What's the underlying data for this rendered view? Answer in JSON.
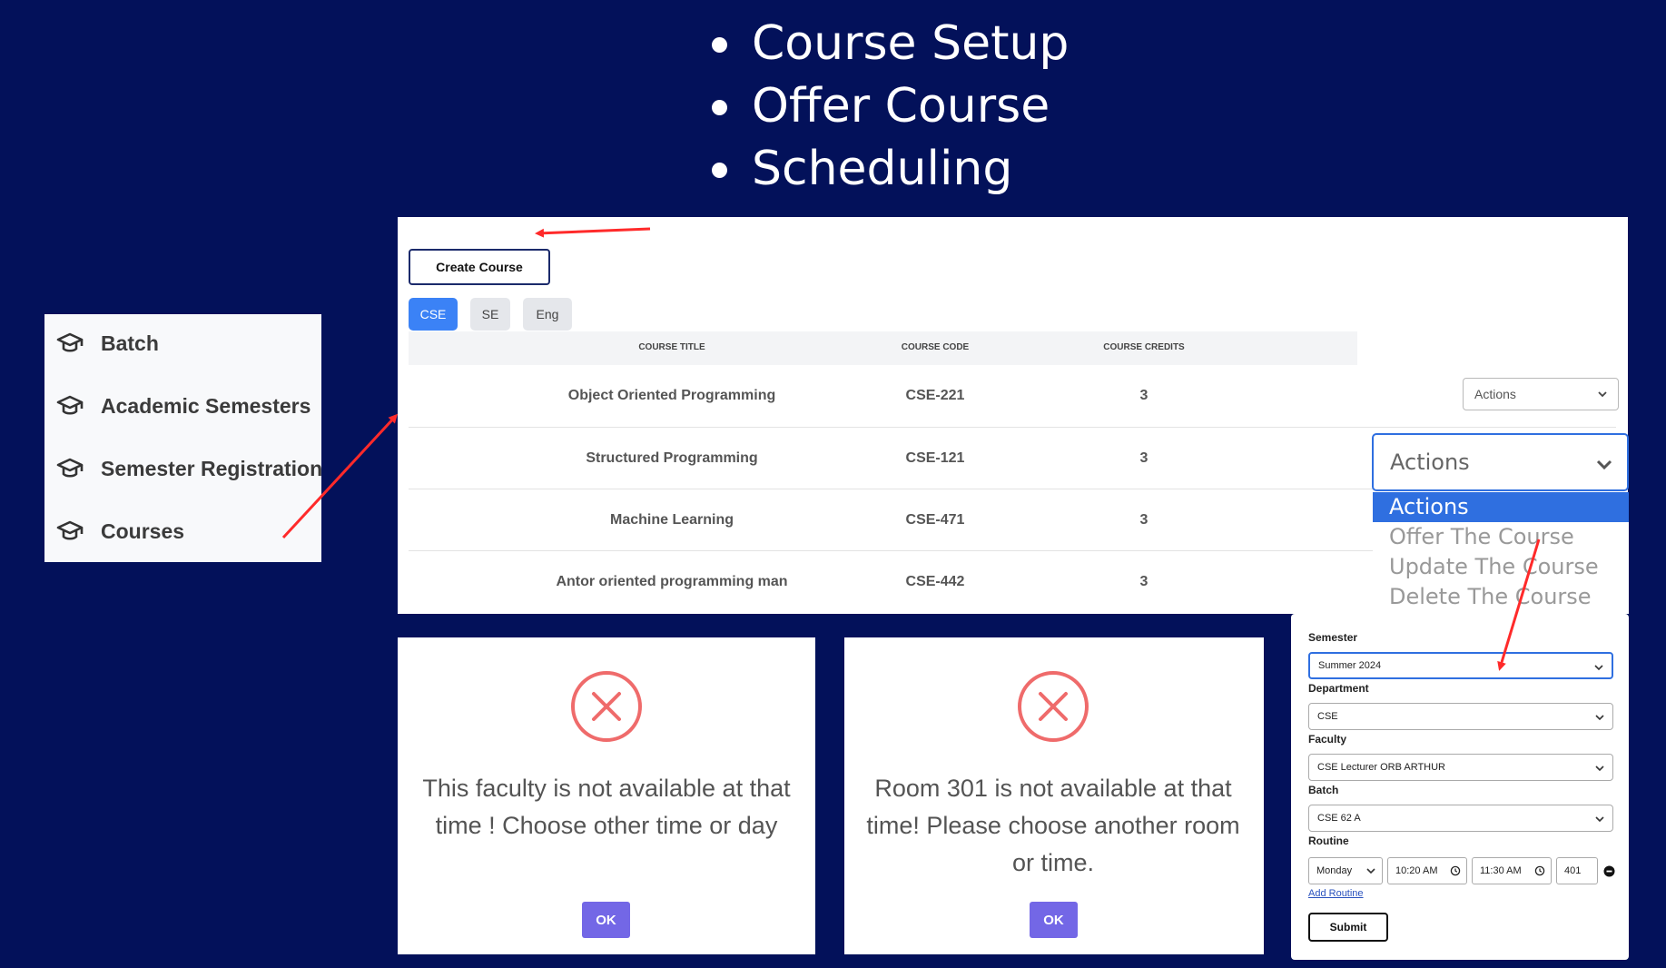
{
  "headline": {
    "bullets": [
      "Course Setup",
      "Offer Course",
      "Scheduling"
    ]
  },
  "sidebar": {
    "items": [
      {
        "label": "Batch",
        "icon": "graduation-cap-icon"
      },
      {
        "label": "Academic Semesters",
        "icon": "graduation-cap-icon"
      },
      {
        "label": "Semester Registration",
        "icon": "graduation-cap-icon"
      },
      {
        "label": "Courses",
        "icon": "graduation-cap-icon"
      }
    ]
  },
  "courses": {
    "create_label": "Create Course",
    "tabs": [
      {
        "label": "CSE",
        "active": true
      },
      {
        "label": "SE",
        "active": false
      },
      {
        "label": "Eng",
        "active": false
      }
    ],
    "columns": [
      "COURSE TITLE",
      "COURSE CODE",
      "COURSE CREDITS"
    ],
    "rows": [
      {
        "title": "Object Oriented Programming",
        "code": "CSE-221",
        "credits": "3"
      },
      {
        "title": "Structured Programming",
        "code": "CSE-121",
        "credits": "3"
      },
      {
        "title": "Machine Learning",
        "code": "CSE-471",
        "credits": "3"
      },
      {
        "title": "Antor oriented programming man",
        "code": "CSE-442",
        "credits": "3"
      }
    ],
    "actions_label": "Actions"
  },
  "actions_dropdown": {
    "value": "Actions",
    "options": [
      "Actions",
      "Offer The Course",
      "Update The Course",
      "Delete The Course"
    ],
    "selected_color": "#2f6fe0"
  },
  "modals": [
    {
      "message": "This faculty is not available at that time ! Choose other time or day",
      "ok_label": "OK",
      "icon": "error-x-icon"
    },
    {
      "message": "Room 301 is not available at that time! Please choose another room or time.",
      "ok_label": "OK",
      "icon": "error-x-icon"
    }
  ],
  "offer_form": {
    "semester_label": "Semester",
    "semester_value": "Summer 2024",
    "department_label": "Department",
    "department_value": "CSE",
    "faculty_label": "Faculty",
    "faculty_value": "CSE Lecturer ORB ARTHUR",
    "batch_label": "Batch",
    "batch_value": "CSE 62 A",
    "routine_label": "Routine",
    "routine": {
      "day": "Monday",
      "start": "10:20 AM",
      "end": "11:30 AM",
      "room": "401"
    },
    "add_routine_label": "Add Routine",
    "submit_label": "Submit"
  },
  "colors": {
    "background": "#03115a",
    "accent_blue": "#3b82f6",
    "ok_button": "#7367e6",
    "error_red": "#ef6b6b",
    "arrow_red": "#ff2a2a"
  }
}
